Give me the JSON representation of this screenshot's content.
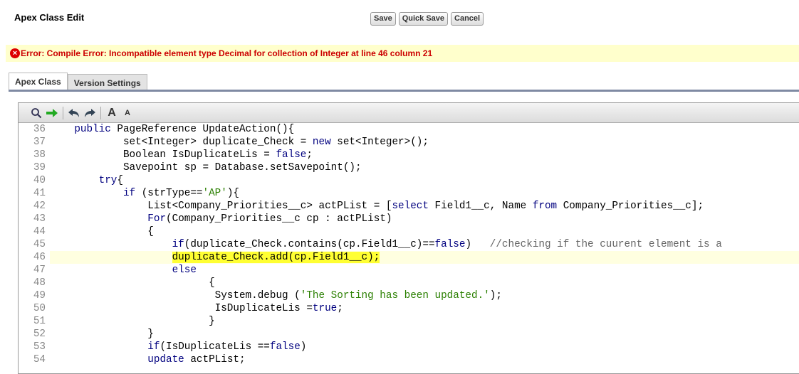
{
  "header": {
    "title": "Apex Class Edit",
    "buttons": {
      "save": "Save",
      "quick_save": "Quick Save",
      "cancel": "Cancel"
    }
  },
  "error": {
    "icon": "error-icon",
    "message": "Error: Compile Error: Incompatible element type Decimal for collection of Integer at line 46 column 21"
  },
  "tabs": [
    {
      "label": "Apex Class",
      "active": true
    },
    {
      "label": "Version Settings",
      "active": false
    }
  ],
  "toolbar": {
    "icons": [
      "search-icon",
      "go-to-line-icon",
      "undo-icon",
      "redo-icon",
      "font-larger-icon",
      "font-smaller-icon"
    ],
    "font_larger": "A",
    "font_smaller": "A"
  },
  "code": {
    "highlighted_line": 46,
    "lines": [
      {
        "n": "36",
        "indent": "    ",
        "text": "public PageReference UpdateAction(){"
      },
      {
        "n": "37",
        "indent": "            ",
        "text": "set<Integer> duplicate_Check = new set<Integer>();"
      },
      {
        "n": "38",
        "indent": "            ",
        "text": "Boolean IsDuplicateLis = false;"
      },
      {
        "n": "39",
        "indent": "            ",
        "text": "Savepoint sp = Database.setSavepoint();"
      },
      {
        "n": "40",
        "indent": "        ",
        "text": "try{"
      },
      {
        "n": "41",
        "indent": "            ",
        "text": "if (strType=='AP'){"
      },
      {
        "n": "42",
        "indent": "                ",
        "text": "List<Company_Priorities__c> actPList = [select Field1__c, Name from Company_Priorities__c];"
      },
      {
        "n": "43",
        "indent": "                ",
        "text": "For(Company_Priorities__c cp : actPList)"
      },
      {
        "n": "44",
        "indent": "                ",
        "text": "{"
      },
      {
        "n": "45",
        "indent": "                    ",
        "text": "if(duplicate_Check.contains(cp.Field1__c)==false)   //checking if the cuurent element is a"
      },
      {
        "n": "46",
        "indent": "                    ",
        "text": "duplicate_Check.add(cp.Field1__c);"
      },
      {
        "n": "47",
        "indent": "                    ",
        "text": "else"
      },
      {
        "n": "48",
        "indent": "                          ",
        "text": "{"
      },
      {
        "n": "49",
        "indent": "                          ",
        "text": " System.debug ('The Sorting has been updated.');"
      },
      {
        "n": "50",
        "indent": "                          ",
        "text": " IsDuplicateLis =true;"
      },
      {
        "n": "51",
        "indent": "                          ",
        "text": "}"
      },
      {
        "n": "52",
        "indent": "                ",
        "text": "}"
      },
      {
        "n": "53",
        "indent": "                ",
        "text": "if(IsDuplicateLis ==false)"
      },
      {
        "n": "54",
        "indent": "                ",
        "text": "update actPList;"
      }
    ]
  }
}
